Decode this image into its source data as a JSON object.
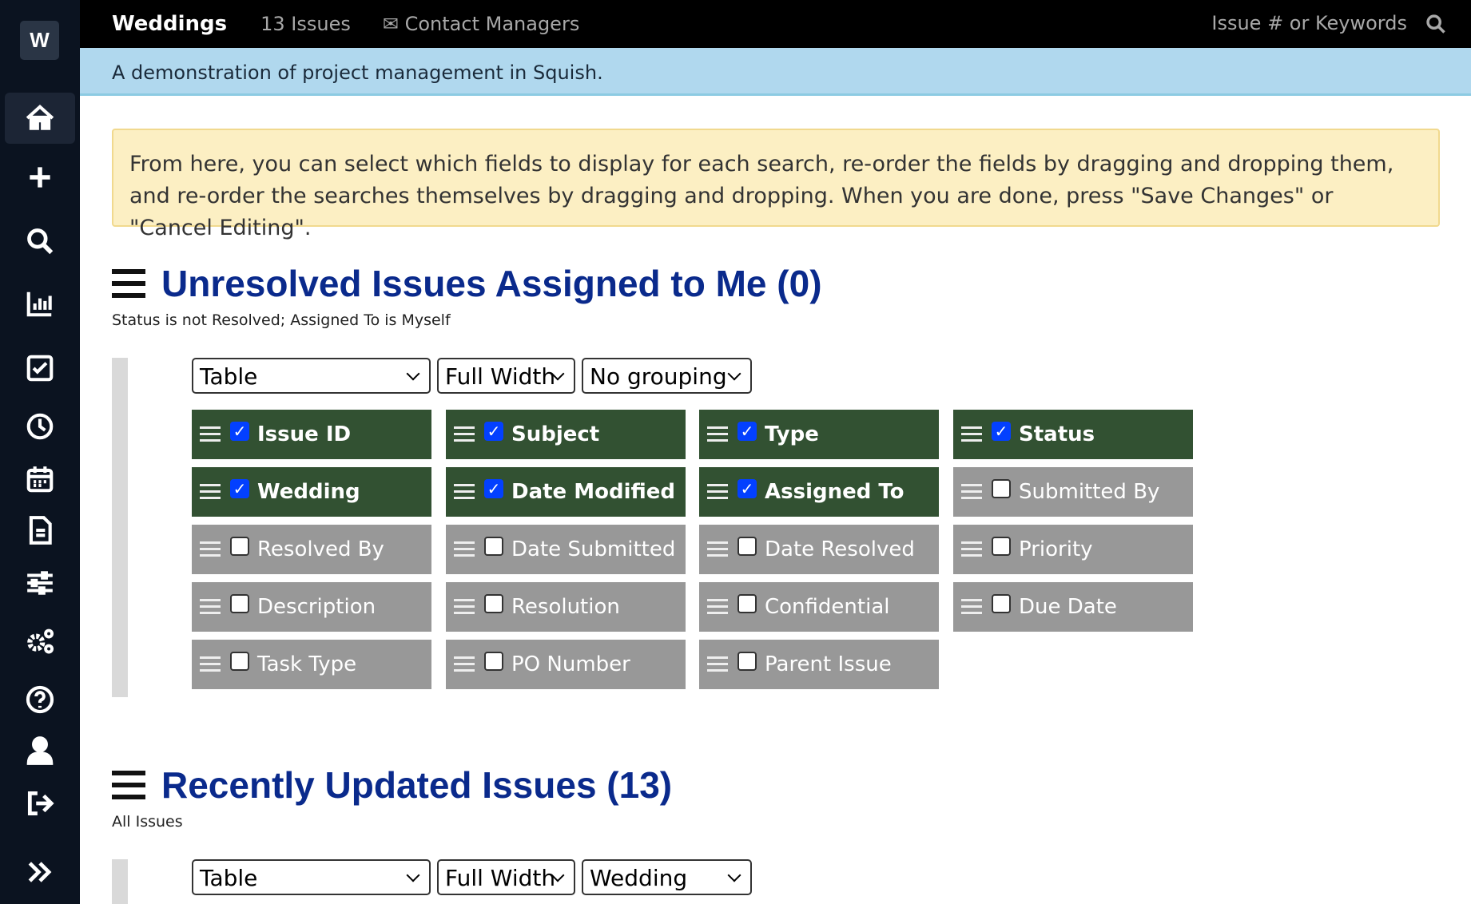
{
  "sidebar": {
    "logo": "W",
    "items": [
      "home",
      "add",
      "search",
      "reports",
      "tasks",
      "history",
      "calendar",
      "document",
      "filters",
      "settings",
      "help",
      "user",
      "logout",
      "expand"
    ]
  },
  "topbar": {
    "project": "Weddings",
    "issues": "13 Issues",
    "contact": "Contact Managers",
    "search_placeholder": "Issue # or Keywords"
  },
  "banner": "A demonstration of project management in Squish.",
  "note": "From here, you can select which fields to display for each search, re-order the fields by dragging and dropping them, and re-order the searches themselves by dragging and dropping. When you are done, press \"Save Changes\" or \"Cancel Editing\".",
  "searches": [
    {
      "title": "Unresolved Issues Assigned to Me (0)",
      "subtitle": "Status is not Resolved; Assigned To is Myself",
      "view": "Table",
      "width": "Full Width",
      "grouping": "No grouping",
      "fields": [
        {
          "label": "Issue ID",
          "checked": true
        },
        {
          "label": "Subject",
          "checked": true
        },
        {
          "label": "Type",
          "checked": true
        },
        {
          "label": "Status",
          "checked": true
        },
        {
          "label": "Wedding",
          "checked": true
        },
        {
          "label": "Date Modified",
          "checked": true
        },
        {
          "label": "Assigned To",
          "checked": true
        },
        {
          "label": "Submitted By",
          "checked": false
        },
        {
          "label": "Resolved By",
          "checked": false
        },
        {
          "label": "Date Submitted",
          "checked": false
        },
        {
          "label": "Date Resolved",
          "checked": false
        },
        {
          "label": "Priority",
          "checked": false
        },
        {
          "label": "Description",
          "checked": false
        },
        {
          "label": "Resolution",
          "checked": false
        },
        {
          "label": "Confidential",
          "checked": false
        },
        {
          "label": "Due Date",
          "checked": false
        },
        {
          "label": "Task Type",
          "checked": false
        },
        {
          "label": "PO Number",
          "checked": false
        },
        {
          "label": "Parent Issue",
          "checked": false
        }
      ]
    },
    {
      "title": "Recently Updated Issues (13)",
      "subtitle": "All Issues",
      "view": "Table",
      "width": "Full Width",
      "grouping": "Wedding"
    }
  ]
}
